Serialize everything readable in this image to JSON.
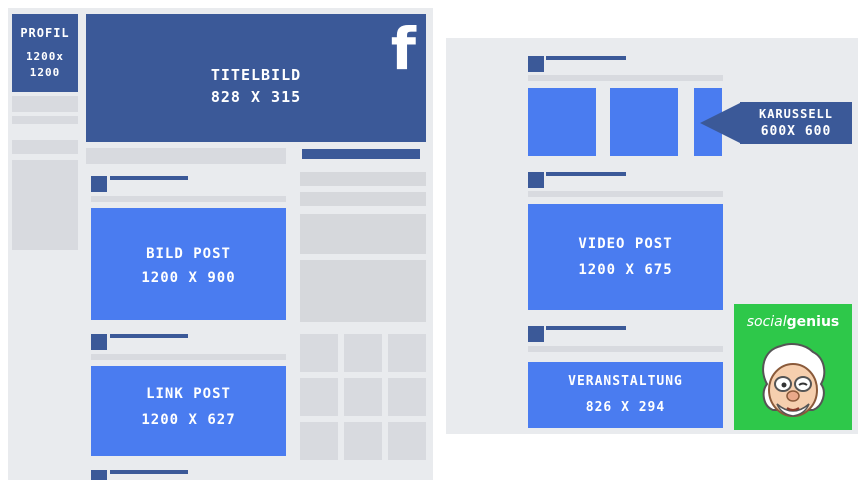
{
  "profile": {
    "line1": "PROFIL",
    "line2": "1200x",
    "line3": "1200"
  },
  "cover": {
    "title": "TITELBILD",
    "size": "828 X 315"
  },
  "facebook_logo": "f",
  "image_post": {
    "title": "BILD POST",
    "size": "1200 X 900"
  },
  "link_post": {
    "title": "LINK POST",
    "size": "1200 X 627"
  },
  "carousel": {
    "title": "KARUSSELL",
    "size": "600X 600"
  },
  "video_post": {
    "title": "VIDEO POST",
    "size": "1200 X 675"
  },
  "event": {
    "title": "VERANSTALTUNG",
    "size": "826 X 294"
  },
  "brand": {
    "part1": "social",
    "part2": "genius"
  },
  "colors": {
    "navy": "#3b5998",
    "blue": "#4a7cf0",
    "panel": "#e9ebee",
    "brand_green": "#2ec84a"
  }
}
